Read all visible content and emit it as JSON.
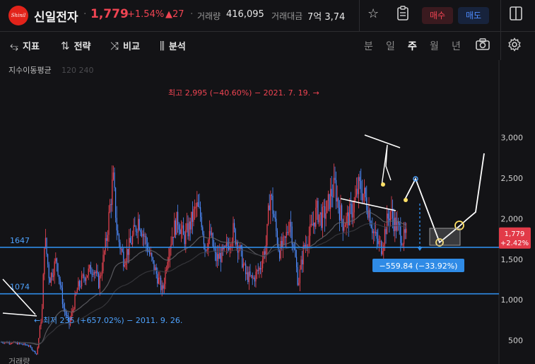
{
  "header": {
    "logo_text": "Shinil",
    "name": "신일전자",
    "price": "1,779",
    "change_pct": "+1.54%",
    "change_abs": "▲27",
    "volume_label": "거래량",
    "volume": "416,095",
    "amount_label": "거래대금",
    "amount": "7억 3,74",
    "buy_label": "매수",
    "sell_label": "매도",
    "up_color": "#f04452",
    "down_color": "#4e8cff"
  },
  "toolbar": {
    "indicator_label": "지표",
    "strategy_label": "전략",
    "compare_label": "비교",
    "analysis_label": "분석",
    "periods": [
      "분",
      "일",
      "주",
      "월",
      "년"
    ],
    "active_period": "주"
  },
  "chart_data": {
    "type": "candlestick",
    "ma_legend": "지수이동평균",
    "ma_periods": "120 240",
    "ylim": [
      0,
      3300
    ],
    "yticks": [
      "500",
      "1,000",
      "1,500",
      "2,000",
      "2,500",
      "3,000"
    ],
    "ytick_values": [
      500,
      1000,
      1500,
      2000,
      2500,
      3000
    ],
    "high_annotation": "최고 2,995 (−40.60%) − 2021. 7. 19.",
    "high_value": 2995,
    "low_annotation": "최저 235 (+657.02%) − 2011. 9. 26.",
    "low_value": 235,
    "current_price": "1,779",
    "current_change": "+2.42%",
    "current_value": 1779,
    "support_lines": [
      {
        "label": "1647",
        "value": 1647
      },
      {
        "label": "1074",
        "value": 1074
      }
    ],
    "measure_label": "−559.84 (−33.92%)",
    "bottom_legend": "거래량"
  }
}
